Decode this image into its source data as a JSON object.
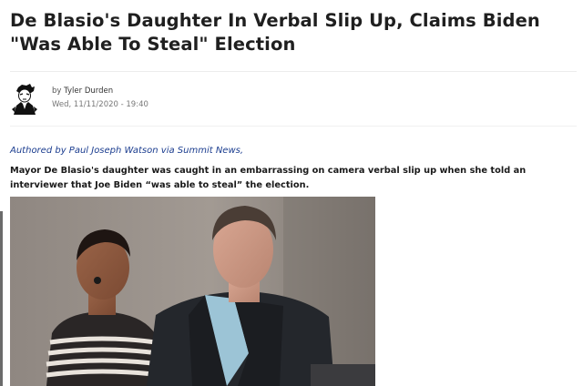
{
  "article": {
    "headline": "De Blasio's Daughter In Verbal Slip Up, Claims Biden \"Was Able To Steal\" Election",
    "byline_prefix": "by",
    "author": "Tyler Durden",
    "date": "Wed, 11/11/2020 - 19:40",
    "authored": "Authored by Paul Joseph Watson via Summit News,",
    "lede": "Mayor De Blasio's daughter was caught in an embarrassing on camera verbal slip up when she told an interviewer that Joe Biden “was able to steal” the election."
  },
  "icons": {
    "author_avatar": "author-avatar-icon"
  }
}
